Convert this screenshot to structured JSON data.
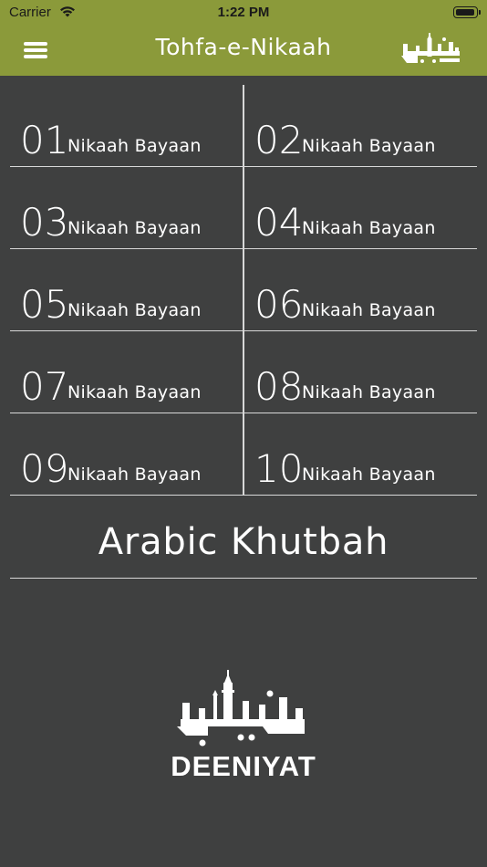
{
  "status_bar": {
    "carrier": "Carrier",
    "time": "1:22 PM"
  },
  "nav": {
    "title": "Tohfa-e-Nikaah",
    "menu_icon": "hamburger-menu-icon",
    "logo_icon": "deeniyat-logo-icon"
  },
  "grid": {
    "rows": [
      {
        "left": {
          "num": "01",
          "label": "Nikaah Bayaan"
        },
        "right": {
          "num": "02",
          "label": "Nikaah Bayaan"
        }
      },
      {
        "left": {
          "num": "03",
          "label": "Nikaah Bayaan"
        },
        "right": {
          "num": "04",
          "label": "Nikaah Bayaan"
        }
      },
      {
        "left": {
          "num": "05",
          "label": "Nikaah Bayaan"
        },
        "right": {
          "num": "06",
          "label": "Nikaah Bayaan"
        }
      },
      {
        "left": {
          "num": "07",
          "label": "Nikaah Bayaan"
        },
        "right": {
          "num": "08",
          "label": "Nikaah Bayaan"
        }
      },
      {
        "left": {
          "num": "09",
          "label": "Nikaah Bayaan"
        },
        "right": {
          "num": "10",
          "label": "Nikaah Bayaan"
        }
      }
    ]
  },
  "khutbah": {
    "label": "Arabic Khutbah"
  },
  "footer": {
    "brand": "DEENIYAT"
  },
  "colors": {
    "header": "#8b9a3a",
    "background": "#3f4040",
    "text": "#ffffff",
    "divider": "#d8d8d8"
  }
}
